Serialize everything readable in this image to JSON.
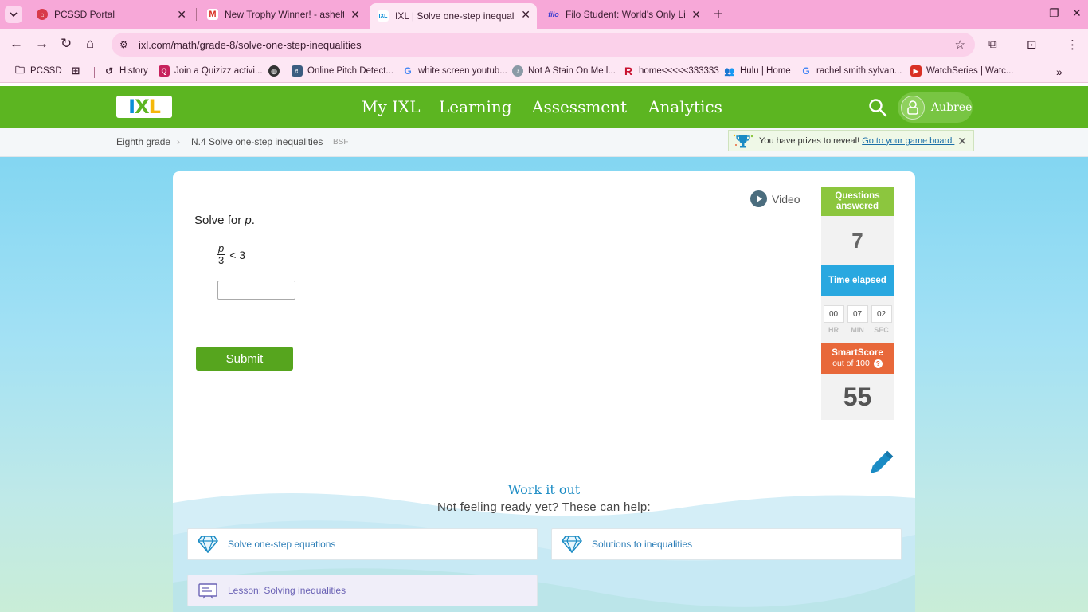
{
  "browser": {
    "tabs": [
      {
        "title": "PCSSD Portal",
        "favicon_color": "#d83a4a"
      },
      {
        "title": "New Trophy Winner! - ashelton",
        "favicon_color": "#d93025"
      },
      {
        "title": "IXL | Solve one-step inequalitie",
        "favicon_color": "#5cb521",
        "active": true
      },
      {
        "title": "Filo Student: World's Only Live",
        "favicon_color": "#3b3fcf"
      }
    ],
    "url": "ixl.com/math/grade-8/solve-one-step-inequalities",
    "bookmarks": [
      {
        "label": "PCSSD",
        "icon": "folder-icon"
      },
      {
        "label": "",
        "icon": "apps-grid-icon"
      },
      {
        "label": "History",
        "icon": "history-icon"
      },
      {
        "label": "Join a Quizizz activi...",
        "icon": "quizizz-icon"
      },
      {
        "label": "",
        "icon": "globe-icon"
      },
      {
        "label": "Online Pitch Detect...",
        "icon": "pitch-icon"
      },
      {
        "label": "white screen youtub...",
        "icon": "google-icon"
      },
      {
        "label": "Not A Stain On Me l...",
        "icon": "music-icon"
      },
      {
        "label": "home<<<<<333333",
        "icon": "r-icon"
      },
      {
        "label": "Hulu | Home",
        "icon": "hulu-icon"
      },
      {
        "label": "rachel smith sylvan...",
        "icon": "google-icon"
      },
      {
        "label": "WatchSeries | Watc...",
        "icon": "play-icon"
      }
    ]
  },
  "ixl": {
    "nav": [
      "My IXL",
      "Learning",
      "Assessment",
      "Analytics"
    ],
    "active_nav": "Learning",
    "user": "Aubree",
    "breadcrumb": {
      "grade": "Eighth grade",
      "skill": "N.4 Solve one-step inequalities",
      "code": "BSF"
    },
    "prize": {
      "text": "You have prizes to reveal!",
      "link": "Go to your game board."
    }
  },
  "practice": {
    "video_label": "Video",
    "prompt_prefix": "Solve for ",
    "prompt_var": "p",
    "prompt_suffix": ".",
    "numerator": "p",
    "denominator": "3",
    "relation": "< 3",
    "answer_value": "",
    "submit_label": "Submit"
  },
  "stats": {
    "questions_label": "Questions answered",
    "questions_value": "7",
    "time_label": "Time elapsed",
    "time": {
      "hr": "00",
      "min": "07",
      "sec": "02"
    },
    "time_units": {
      "hr": "HR",
      "min": "MIN",
      "sec": "SEC"
    },
    "smartscore_label": "SmartScore",
    "smartscore_sub": "out of 100",
    "smartscore_value": "55"
  },
  "work_it_out": {
    "title": "Work it out",
    "subtitle": "Not feeling ready yet? These can help:",
    "resources": [
      {
        "label": "Solve one-step equations",
        "type": "skill"
      },
      {
        "label": "Solutions to inequalities",
        "type": "skill"
      },
      {
        "label": "Lesson: Solving inequalities",
        "type": "lesson"
      }
    ]
  },
  "colors": {
    "ixl_green": "#5cb521",
    "questions_green": "#8cc63e",
    "time_blue": "#29a8e0",
    "smartscore_orange": "#e8683a",
    "tab_strip_pink": "#f7a8d8"
  }
}
